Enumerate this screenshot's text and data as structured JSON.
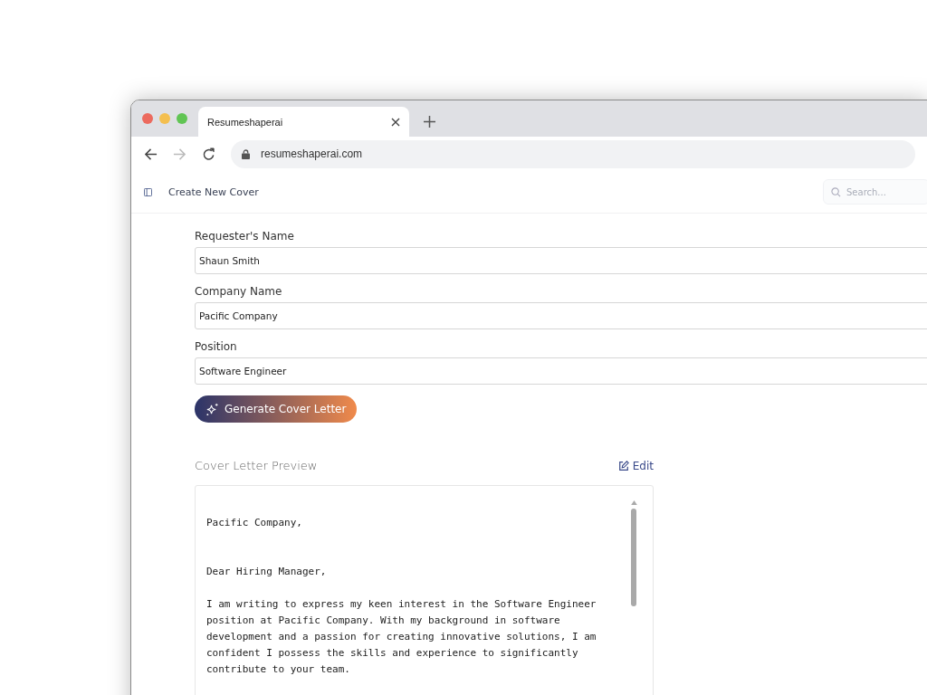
{
  "browser": {
    "tab_title": "Resumeshaperai",
    "url": "resumeshaperai.com"
  },
  "header": {
    "title": "Create New Cover",
    "search": {
      "placeholder": "Search..."
    }
  },
  "form": {
    "fields": [
      {
        "label": "Requester's Name",
        "value": "Shaun Smith"
      },
      {
        "label": "Company Name",
        "value": "Pacific Company"
      },
      {
        "label": "Position",
        "value": "Software Engineer"
      }
    ],
    "button": "Generate Cover Letter"
  },
  "preview": {
    "title": "Cover Letter Preview",
    "edit": "Edit",
    "paragraphs": [
      "Pacific Company,",
      "Dear Hiring Manager,",
      "I am writing to express my keen interest in the Software Engineer position at Pacific Company. With my background in software development and a passion for creating innovative solutions, I am confident I possess the skills and experience to significantly contribute to your team."
    ]
  }
}
